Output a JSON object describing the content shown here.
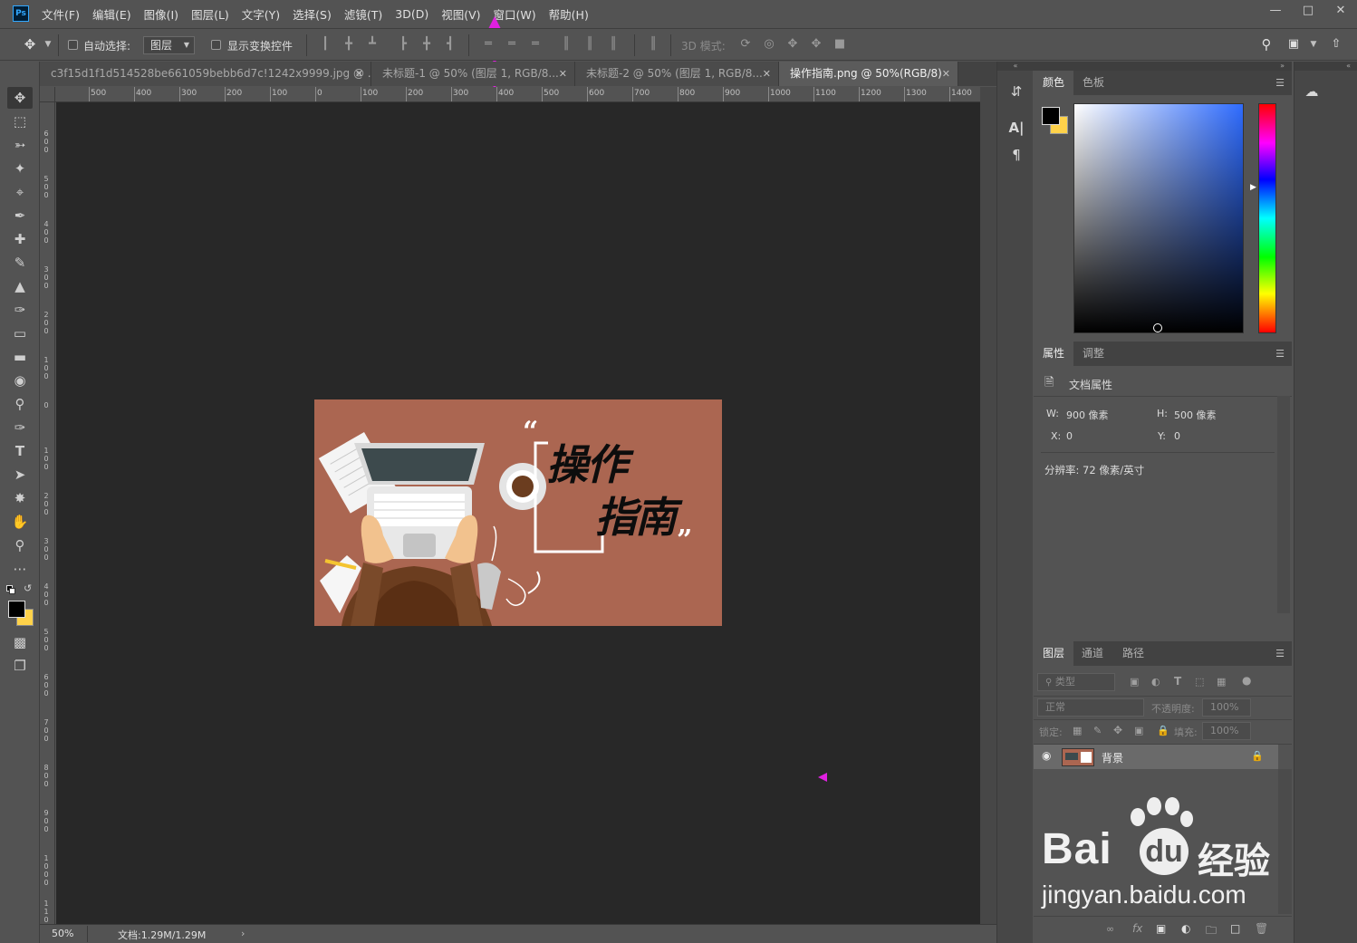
{
  "app": {
    "logo": "Ps",
    "menus": [
      "文件(F)",
      "编辑(E)",
      "图像(I)",
      "图层(L)",
      "文字(Y)",
      "选择(S)",
      "滤镜(T)",
      "3D(D)",
      "视图(V)",
      "窗口(W)",
      "帮助(H)"
    ],
    "window_controls": [
      "minimize-icon",
      "maximize-icon",
      "close-icon"
    ]
  },
  "options": {
    "auto_select_label": "自动选择:",
    "auto_select_value": "图层",
    "show_transform_label": "显示变换控件",
    "mode_3d_label": "3D 模式:"
  },
  "tabs": [
    {
      "label": "c3f15d1f1d514528be661059bebb6d7c!1242x9999.jpg @ ...",
      "active": false
    },
    {
      "label": "未标题-1 @ 50% (图层 1, RGB/8...",
      "active": false
    },
    {
      "label": "未标题-2 @ 50% (图层 1, RGB/8...",
      "active": false
    },
    {
      "label": "操作指南.png @ 50%(RGB/8)",
      "active": true
    }
  ],
  "ruler": {
    "h_ticks": [
      "500",
      "400",
      "300",
      "200",
      "100",
      "0",
      "100",
      "200",
      "300",
      "400",
      "500",
      "600",
      "700",
      "800",
      "900",
      "1000",
      "1100",
      "1200",
      "1300",
      "1400"
    ],
    "v_ticks": [
      "600",
      "500",
      "400",
      "300",
      "200",
      "100",
      "0",
      "100",
      "200",
      "300",
      "400",
      "500",
      "600",
      "700",
      "800",
      "900",
      "1000",
      "1100"
    ]
  },
  "document": {
    "title_line1": "操作",
    "title_line2": "指南",
    "quote_open": "“",
    "quote_close": "”",
    "bg_color": "#ab6651"
  },
  "status": {
    "zoom": "50%",
    "doc_size": "文档:1.29M/1.29M"
  },
  "color_panel": {
    "tabs": [
      "颜色",
      "色板"
    ],
    "foreground": "#000000",
    "background": "#ffd24a"
  },
  "properties_panel": {
    "tabs": [
      "属性",
      "调整"
    ],
    "section": "文档属性",
    "w_label": "W:",
    "w_value": "900 像素",
    "h_label": "H:",
    "h_value": "500 像素",
    "x_label": "X:",
    "x_value": "0",
    "y_label": "Y:",
    "y_value": "0",
    "resolution": "分辨率: 72 像素/英寸"
  },
  "layers_panel": {
    "tabs": [
      "图层",
      "通道",
      "路径"
    ],
    "filter_label": "类型",
    "blend_mode": "正常",
    "opacity_label": "不透明度:",
    "opacity_value": "100%",
    "lock_label": "锁定:",
    "fill_label": "填充:",
    "fill_value": "100%",
    "layers": [
      {
        "name": "背景",
        "locked": true,
        "visible": true
      }
    ]
  },
  "watermark": {
    "brand": "Bai",
    "brand_suffix": "经验",
    "url": "jingyan.baidu.com"
  },
  "colors": {
    "accent_arrow": "#e020e0",
    "panel_bg": "#535353",
    "canvas_bg": "#282828"
  }
}
